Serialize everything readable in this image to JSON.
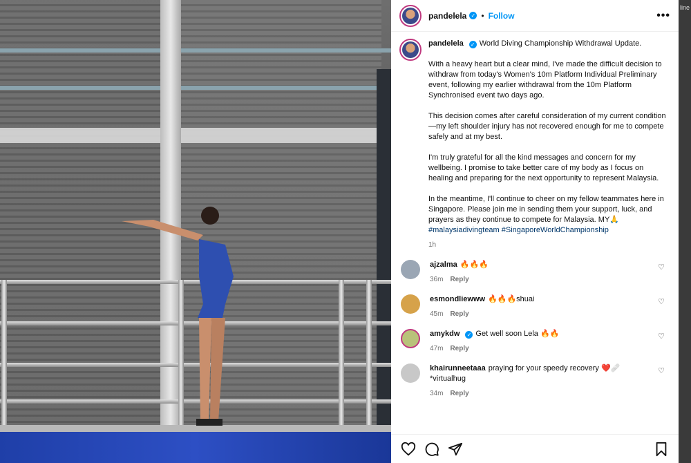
{
  "post": {
    "username": "pandelela",
    "follow_label": "Follow",
    "dot": "•",
    "more": "•••",
    "caption": {
      "headline": "World Diving Championship Withdrawal Update.",
      "para1": "With a heavy heart but a clear mind, I've made the difficult decision to withdraw from today's Women's 10m Platform Individual Preliminary event, following my earlier withdrawal from the 10m Platform Synchronised event two days ago.",
      "para2": "This decision comes after careful consideration of my current condition—my left shoulder injury has not recovered enough for me to compete safely and at my best.",
      "para3": "I'm truly grateful for all the kind messages and concern for my wellbeing. I promise to take better care of my body as I focus on healing and preparing for the next opportunity to represent Malaysia.",
      "para4": "In the meantime, I'll continue to cheer on my fellow teammates here in Singapore. Please join me in sending them your support, luck, and prayers as they continue to compete for Malaysia. MY🙏",
      "hashtags": "#malaysiadivingteam #SingaporeWorldChampionship",
      "time": "1h"
    }
  },
  "comments": [
    {
      "user": "ajzalma",
      "text": "🔥🔥🔥",
      "time": "36m",
      "reply": "Reply",
      "verified": false,
      "avatar_color": "#9aa6b4"
    },
    {
      "user": "esmondliewww",
      "text": "🔥🔥🔥shuai",
      "time": "45m",
      "reply": "Reply",
      "verified": false,
      "avatar_color": "#d6a24a"
    },
    {
      "user": "amykdw",
      "text": "Get well soon Lela 🔥🔥",
      "time": "47m",
      "reply": "Reply",
      "verified": true,
      "avatar_color": "#b9c27a"
    },
    {
      "user": "khairunneetaaa",
      "text": "praying for your speedy recovery ❤️🩹 *virtualhug",
      "time": "34m",
      "reply": "Reply",
      "verified": false,
      "avatar_color": "#c8c8c8"
    }
  ],
  "edge_tag": "line",
  "colors": {
    "accent": "#0095f6",
    "link": "#00376b",
    "muted": "#737373"
  }
}
